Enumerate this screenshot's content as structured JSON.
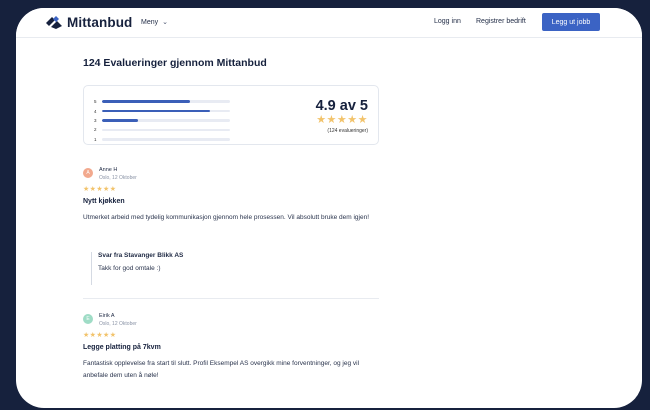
{
  "header": {
    "logo_text": "Mittanbud",
    "menu_label": "Meny",
    "login": "Logg inn",
    "register": "Registrer bedrift",
    "post_job": "Legg ut jobb"
  },
  "page": {
    "title": "124 Evalueringer gjennom Mittanbud"
  },
  "summary": {
    "score": "4.9 av 5",
    "stars": "★★★★★",
    "count": "(124 evalueringer)",
    "distribution": [
      {
        "label": "5",
        "fraction": 0.69
      },
      {
        "label": "4",
        "fraction": 0.84
      },
      {
        "label": "3",
        "fraction": 0.28
      },
      {
        "label": "2",
        "fraction": 0.0
      },
      {
        "label": "1",
        "fraction": 0.0
      }
    ]
  },
  "reviews": [
    {
      "initial": "A",
      "avatar_color": "#f2a98e",
      "name": "Anne H",
      "meta": "Oslo, 12 Oktober",
      "stars": "★★★★★",
      "title": "Nytt kjøkken",
      "text": "Utmerket arbeid med tydelig kommunikasjon gjennom hele prosessen. Vil absolutt bruke dem igjen!",
      "reply_title": "Svar fra Stavanger Blikk AS",
      "reply_text": "Takk for god omtale :)"
    },
    {
      "initial": "E",
      "avatar_color": "#9fdcc6",
      "name": "Eirik A",
      "meta": "Oslo, 12 Oktober",
      "stars": "★★★★★",
      "title": "Legge platting på 7kvm",
      "text": "Fantastisk opplevelse fra start til slutt. Profil Eksempel AS overgikk mine forventninger, og jeg vil anbefale dem uten å nøle!"
    }
  ],
  "colors": {
    "accent": "#3b63c4",
    "star": "#f2c36b",
    "frame": "#16213d"
  }
}
